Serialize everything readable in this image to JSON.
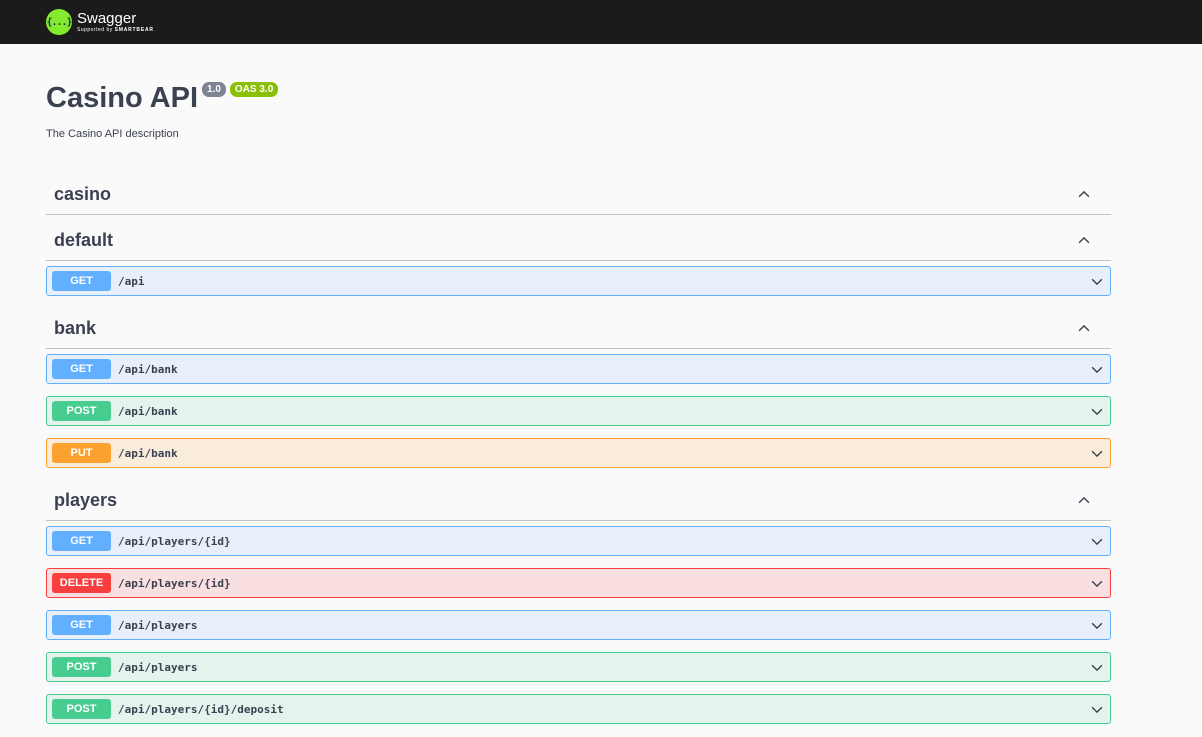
{
  "topbar": {
    "logo_glyph": "{...}",
    "brand": "Swagger",
    "sub_prefix": "Supported by",
    "sub_brand": "SMARTBEAR"
  },
  "info": {
    "title": "Casino API",
    "version": "1.0",
    "oas": "OAS 3.0",
    "description": "The Casino API description"
  },
  "colors": {
    "get": "#61affe",
    "post": "#49cc90",
    "put": "#fca130",
    "delete": "#f93e3e"
  },
  "tags": [
    {
      "name": "casino",
      "ops": []
    },
    {
      "name": "default",
      "ops": [
        {
          "method": "GET",
          "path": "/api"
        }
      ]
    },
    {
      "name": "bank",
      "ops": [
        {
          "method": "GET",
          "path": "/api/bank"
        },
        {
          "method": "POST",
          "path": "/api/bank"
        },
        {
          "method": "PUT",
          "path": "/api/bank"
        }
      ]
    },
    {
      "name": "players",
      "ops": [
        {
          "method": "GET",
          "path": "/api/players/{id}"
        },
        {
          "method": "DELETE",
          "path": "/api/players/{id}"
        },
        {
          "method": "GET",
          "path": "/api/players"
        },
        {
          "method": "POST",
          "path": "/api/players"
        },
        {
          "method": "POST",
          "path": "/api/players/{id}/deposit"
        }
      ]
    }
  ]
}
